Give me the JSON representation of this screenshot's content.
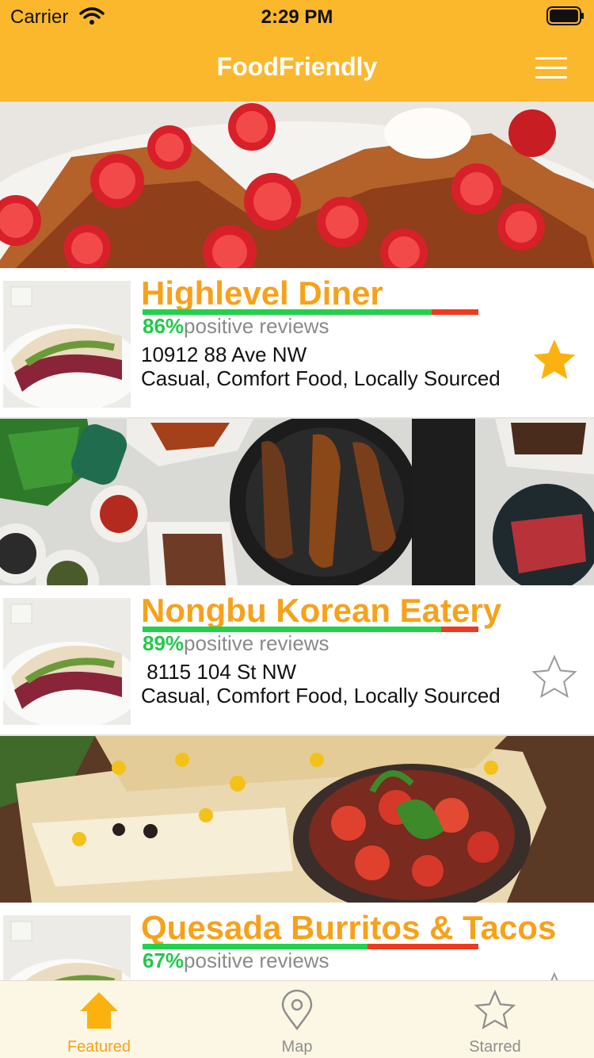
{
  "status_bar": {
    "carrier": "Carrier",
    "time": "2:29 PM"
  },
  "header": {
    "title": "FoodFriendly"
  },
  "colors": {
    "brand": "#fbb82d",
    "accent": "#f7a11b",
    "positive": "#22c94a",
    "negative": "#ef3a1f",
    "tab_bar": "#fcf7e5"
  },
  "restaurants": [
    {
      "name": "Highlevel Diner",
      "positive_pct": "86%",
      "positive_fraction": 0.86,
      "reviews_label": "positive reviews",
      "address": "10912 88 Ave NW",
      "tags": "Casual, Comfort Food, Locally Sourced",
      "starred": true,
      "banner_image": "french-toast-strawberries",
      "thumbnail_image": "tacos-plate"
    },
    {
      "name": "Nongbu Korean Eatery",
      "positive_pct": "89%",
      "positive_fraction": 0.89,
      "reviews_label": "positive reviews",
      "address": " 8115 104 St NW",
      "tags": "Casual, Comfort Food, Locally Sourced",
      "starred": false,
      "banner_image": "korean-bbq-grill",
      "thumbnail_image": "tacos-plate"
    },
    {
      "name": "Quesada Burritos & Tacos",
      "positive_pct": "67%",
      "positive_fraction": 0.67,
      "reviews_label": "positive reviews",
      "address": "",
      "tags": "",
      "starred": false,
      "banner_image": "quesadilla-salsa",
      "thumbnail_image": "tacos-plate"
    }
  ],
  "tab_bar": {
    "tabs": [
      {
        "label": "Featured",
        "icon": "home-icon",
        "active": true
      },
      {
        "label": "Map",
        "icon": "map-pin-icon",
        "active": false
      },
      {
        "label": "Starred",
        "icon": "star-outline-icon",
        "active": false
      }
    ]
  }
}
